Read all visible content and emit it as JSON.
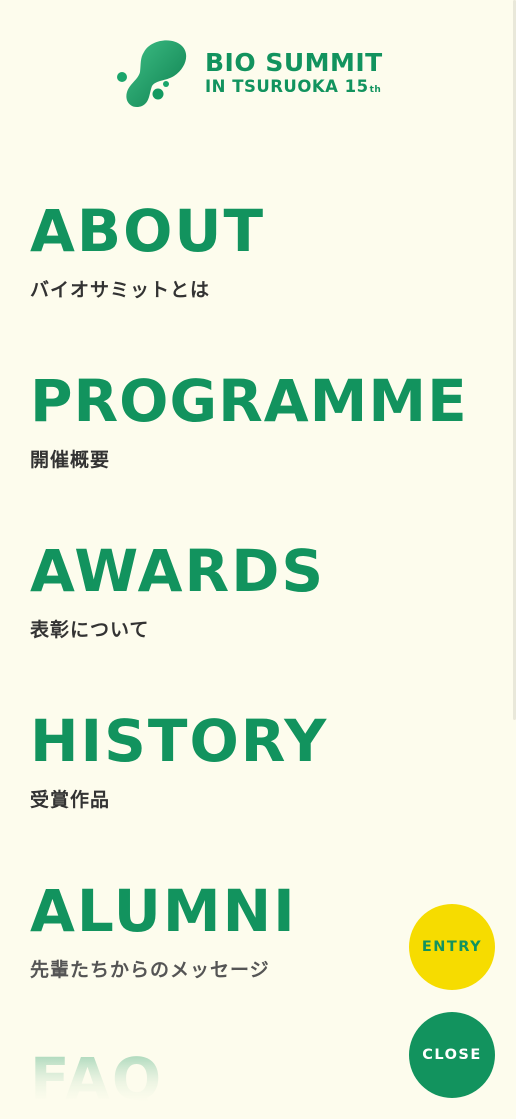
{
  "colors": {
    "background": "#fdfced",
    "brand_green": "#12935e",
    "entry_yellow": "#f6dc00",
    "subtitle_text": "#333333"
  },
  "header": {
    "logo_icon": "bio-summit-blob-icon",
    "logo_line1": "BIO SUMMIT",
    "logo_line2": "IN TSURUOKA 15",
    "logo_ordinal": "th"
  },
  "nav": {
    "items": [
      {
        "title": "ABOUT",
        "subtitle": "バイオサミットとは"
      },
      {
        "title": "PROGRAMME",
        "subtitle": "開催概要"
      },
      {
        "title": "AWARDS",
        "subtitle": "表彰について"
      },
      {
        "title": "HISTORY",
        "subtitle": "受賞作品"
      },
      {
        "title": "ALUMNI",
        "subtitle": "先輩たちからのメッセージ"
      },
      {
        "title": "FAQ",
        "subtitle": ""
      }
    ]
  },
  "buttons": {
    "entry_label": "ENTRY",
    "close_label": "CLOSE"
  }
}
